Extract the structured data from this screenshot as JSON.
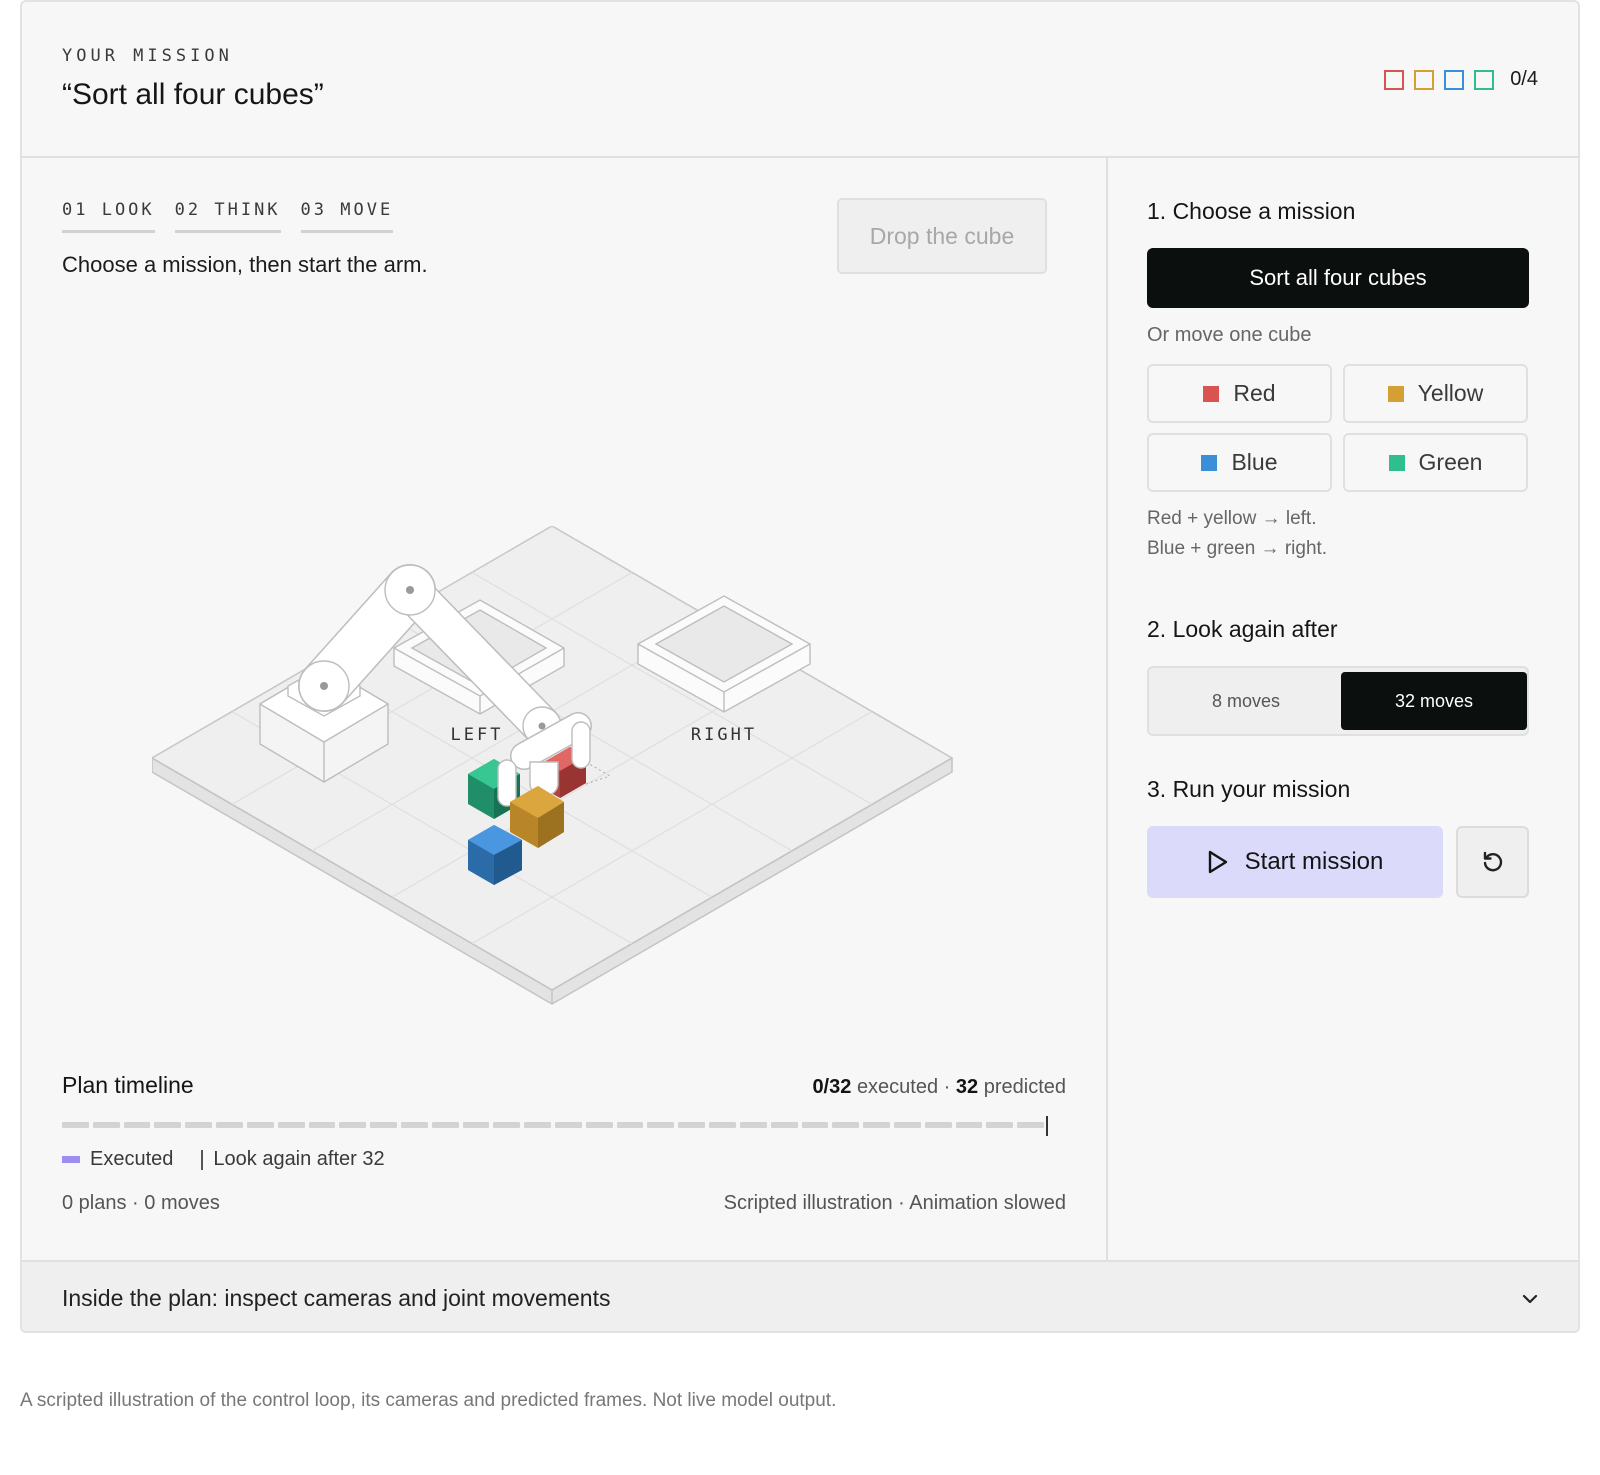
{
  "mission": {
    "eyebrow": "YOUR MISSION",
    "title": "“Sort all four cubes”",
    "progress_count": "0/4",
    "progress_colors": [
      "#d9534f",
      "#d4a033",
      "#3b8fd9",
      "#2fbf8f"
    ]
  },
  "stage": {
    "steps": [
      "01 LOOK",
      "02 THINK",
      "03 MOVE"
    ],
    "instruction": "Choose a mission, then start the arm.",
    "drop_button": "Drop the cube",
    "zone_left": "LEFT",
    "zone_right": "RIGHT"
  },
  "timeline": {
    "title": "Plan timeline",
    "executed": "0/32",
    "executed_label": "executed",
    "separator": "·",
    "predicted": "32",
    "predicted_label": "predicted",
    "total_segments": 32,
    "executed_segments": 0,
    "legend_executed": "Executed",
    "legend_look_again": "Look again after 32",
    "meta_left": "0 plans · 0 moves",
    "meta_right": "Scripted illustration · Animation slowed"
  },
  "panel": {
    "section1_title": "1. Choose a mission",
    "primary_mission": "Sort all four cubes",
    "or_label": "Or move one cube",
    "cubes": [
      {
        "label": "Red",
        "color": "#d9534f"
      },
      {
        "label": "Yellow",
        "color": "#d4a033"
      },
      {
        "label": "Blue",
        "color": "#3b8fd9"
      },
      {
        "label": "Green",
        "color": "#2fbf8f"
      }
    ],
    "hint_line1": "Red + yellow → left.",
    "hint_line2": "Blue + green → right.",
    "section2_title": "2. Look again after",
    "option_8": "8 moves",
    "option_32": "32 moves",
    "selected_option": "32 moves",
    "section3_title": "3. Run your mission",
    "start_label": "Start mission"
  },
  "accordion": {
    "label": "Inside the plan: inspect cameras and joint movements"
  },
  "footnote": "A scripted illustration of the control loop, its cameras and predicted frames. Not live model output.",
  "icons": {
    "play": "play-icon",
    "reset": "reset-icon",
    "chevron": "chevron-down-icon"
  }
}
